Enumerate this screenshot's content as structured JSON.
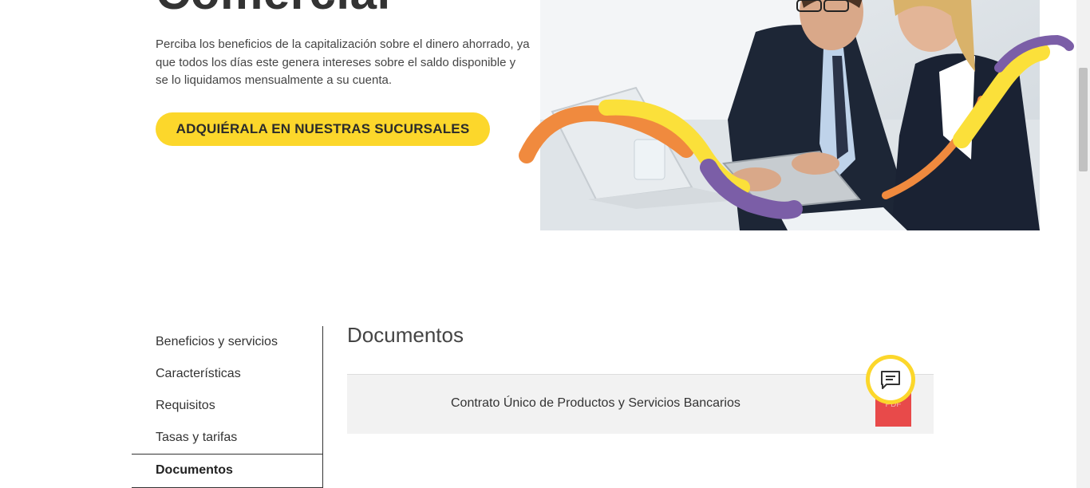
{
  "hero": {
    "title": "Comercial",
    "description": "Perciba los beneficios de la capitalización sobre el dinero ahorrado, ya que todos los días este genera intereses sobre el saldo disponible y se lo liquidamos mensualmente a su cuenta.",
    "cta_label": "ADQUIÉRALA EN NUESTRAS SUCURSALES"
  },
  "side_nav": {
    "items": [
      {
        "label": "Beneficios y servicios"
      },
      {
        "label": "Características"
      },
      {
        "label": "Requisitos"
      },
      {
        "label": "Tasas y tarifas"
      },
      {
        "label": "Documentos"
      }
    ],
    "active": "Documentos"
  },
  "documents": {
    "title": "Documentos",
    "items": [
      {
        "name": "Contrato Único de Productos y Servicios Bancarios",
        "badge": "PDF"
      }
    ]
  },
  "chat": {
    "icon": "chat-icon"
  },
  "colors": {
    "accent_yellow": "#fcd72b",
    "pdf_red": "#e84a4a",
    "wave_orange": "#f08a3e",
    "wave_purple": "#7b5ea7"
  }
}
